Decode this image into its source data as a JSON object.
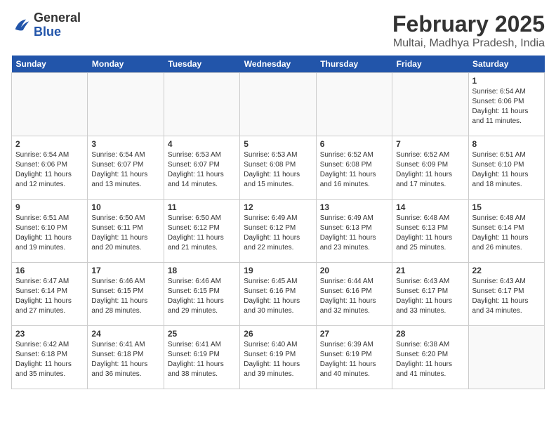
{
  "header": {
    "logo_general": "General",
    "logo_blue": "Blue",
    "month_title": "February 2025",
    "location": "Multai, Madhya Pradesh, India"
  },
  "days_of_week": [
    "Sunday",
    "Monday",
    "Tuesday",
    "Wednesday",
    "Thursday",
    "Friday",
    "Saturday"
  ],
  "weeks": [
    [
      {
        "day": "",
        "info": ""
      },
      {
        "day": "",
        "info": ""
      },
      {
        "day": "",
        "info": ""
      },
      {
        "day": "",
        "info": ""
      },
      {
        "day": "",
        "info": ""
      },
      {
        "day": "",
        "info": ""
      },
      {
        "day": "1",
        "info": "Sunrise: 6:54 AM\nSunset: 6:06 PM\nDaylight: 11 hours\nand 11 minutes."
      }
    ],
    [
      {
        "day": "2",
        "info": "Sunrise: 6:54 AM\nSunset: 6:06 PM\nDaylight: 11 hours\nand 12 minutes."
      },
      {
        "day": "3",
        "info": "Sunrise: 6:54 AM\nSunset: 6:07 PM\nDaylight: 11 hours\nand 13 minutes."
      },
      {
        "day": "4",
        "info": "Sunrise: 6:53 AM\nSunset: 6:07 PM\nDaylight: 11 hours\nand 14 minutes."
      },
      {
        "day": "5",
        "info": "Sunrise: 6:53 AM\nSunset: 6:08 PM\nDaylight: 11 hours\nand 15 minutes."
      },
      {
        "day": "6",
        "info": "Sunrise: 6:52 AM\nSunset: 6:08 PM\nDaylight: 11 hours\nand 16 minutes."
      },
      {
        "day": "7",
        "info": "Sunrise: 6:52 AM\nSunset: 6:09 PM\nDaylight: 11 hours\nand 17 minutes."
      },
      {
        "day": "8",
        "info": "Sunrise: 6:51 AM\nSunset: 6:10 PM\nDaylight: 11 hours\nand 18 minutes."
      }
    ],
    [
      {
        "day": "9",
        "info": "Sunrise: 6:51 AM\nSunset: 6:10 PM\nDaylight: 11 hours\nand 19 minutes."
      },
      {
        "day": "10",
        "info": "Sunrise: 6:50 AM\nSunset: 6:11 PM\nDaylight: 11 hours\nand 20 minutes."
      },
      {
        "day": "11",
        "info": "Sunrise: 6:50 AM\nSunset: 6:12 PM\nDaylight: 11 hours\nand 21 minutes."
      },
      {
        "day": "12",
        "info": "Sunrise: 6:49 AM\nSunset: 6:12 PM\nDaylight: 11 hours\nand 22 minutes."
      },
      {
        "day": "13",
        "info": "Sunrise: 6:49 AM\nSunset: 6:13 PM\nDaylight: 11 hours\nand 23 minutes."
      },
      {
        "day": "14",
        "info": "Sunrise: 6:48 AM\nSunset: 6:13 PM\nDaylight: 11 hours\nand 25 minutes."
      },
      {
        "day": "15",
        "info": "Sunrise: 6:48 AM\nSunset: 6:14 PM\nDaylight: 11 hours\nand 26 minutes."
      }
    ],
    [
      {
        "day": "16",
        "info": "Sunrise: 6:47 AM\nSunset: 6:14 PM\nDaylight: 11 hours\nand 27 minutes."
      },
      {
        "day": "17",
        "info": "Sunrise: 6:46 AM\nSunset: 6:15 PM\nDaylight: 11 hours\nand 28 minutes."
      },
      {
        "day": "18",
        "info": "Sunrise: 6:46 AM\nSunset: 6:15 PM\nDaylight: 11 hours\nand 29 minutes."
      },
      {
        "day": "19",
        "info": "Sunrise: 6:45 AM\nSunset: 6:16 PM\nDaylight: 11 hours\nand 30 minutes."
      },
      {
        "day": "20",
        "info": "Sunrise: 6:44 AM\nSunset: 6:16 PM\nDaylight: 11 hours\nand 32 minutes."
      },
      {
        "day": "21",
        "info": "Sunrise: 6:43 AM\nSunset: 6:17 PM\nDaylight: 11 hours\nand 33 minutes."
      },
      {
        "day": "22",
        "info": "Sunrise: 6:43 AM\nSunset: 6:17 PM\nDaylight: 11 hours\nand 34 minutes."
      }
    ],
    [
      {
        "day": "23",
        "info": "Sunrise: 6:42 AM\nSunset: 6:18 PM\nDaylight: 11 hours\nand 35 minutes."
      },
      {
        "day": "24",
        "info": "Sunrise: 6:41 AM\nSunset: 6:18 PM\nDaylight: 11 hours\nand 36 minutes."
      },
      {
        "day": "25",
        "info": "Sunrise: 6:41 AM\nSunset: 6:19 PM\nDaylight: 11 hours\nand 38 minutes."
      },
      {
        "day": "26",
        "info": "Sunrise: 6:40 AM\nSunset: 6:19 PM\nDaylight: 11 hours\nand 39 minutes."
      },
      {
        "day": "27",
        "info": "Sunrise: 6:39 AM\nSunset: 6:19 PM\nDaylight: 11 hours\nand 40 minutes."
      },
      {
        "day": "28",
        "info": "Sunrise: 6:38 AM\nSunset: 6:20 PM\nDaylight: 11 hours\nand 41 minutes."
      },
      {
        "day": "",
        "info": ""
      }
    ]
  ]
}
